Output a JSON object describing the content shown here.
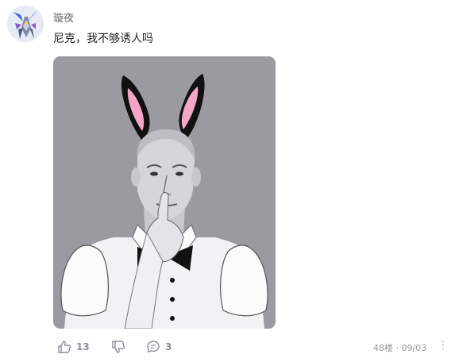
{
  "comment": {
    "username": "璇夜",
    "text": "尼克，我不够诱人吗",
    "image_alt": "bunny-ears-man-illustration"
  },
  "actions": {
    "likes": "13",
    "replies": "3"
  },
  "meta": {
    "floor": "48楼",
    "separator": "·",
    "date": "09/03"
  },
  "more_glyph": "···",
  "colors": {
    "text_primary": "#222222",
    "text_secondary": "#8a8f99",
    "image_bg": "#9c9aa1",
    "ear_inner": "#f4a6c6"
  }
}
